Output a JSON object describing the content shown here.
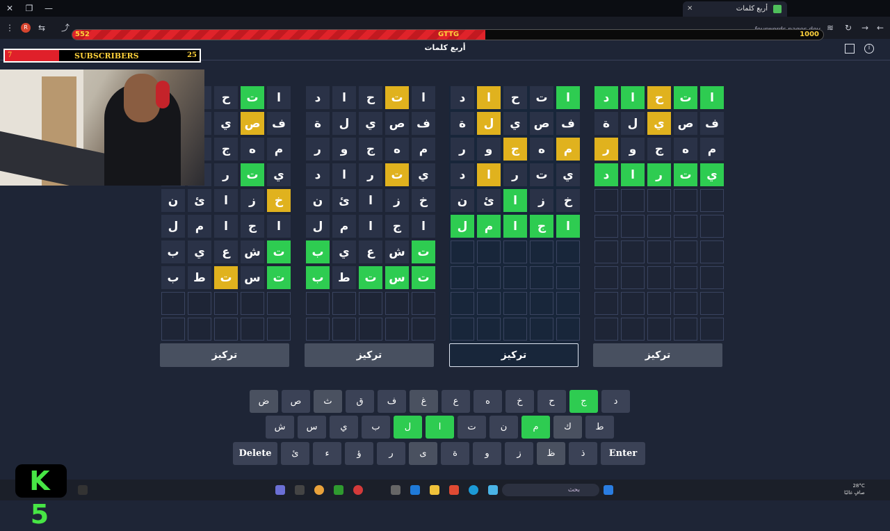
{
  "browser": {
    "tab_title": "أربع كلمات",
    "url": "fourwords.pages.dev"
  },
  "overlay": {
    "goal_bar": {
      "left": "552",
      "mid": "GTTG",
      "right": "1000",
      "progress": 0.55
    },
    "subscribers": {
      "left": "7",
      "label": "SUBSCRIBERS",
      "right": "25",
      "progress": 0.28
    },
    "logo": "K 5"
  },
  "page": {
    "title": "أربع كلمات"
  },
  "focus_label": "تركيز",
  "boards": [
    {
      "id": "board-1",
      "active": false,
      "rows": [
        [
          [
            "ا",
            "g"
          ],
          [
            "ت",
            "g"
          ],
          [
            "ح",
            "y"
          ],
          [
            "ا",
            "g"
          ],
          [
            "د",
            "g"
          ]
        ],
        [
          [
            "ف",
            "n"
          ],
          [
            "ص",
            "n"
          ],
          [
            "ي",
            "y"
          ],
          [
            "ل",
            "n"
          ],
          [
            "ة",
            "n"
          ]
        ],
        [
          [
            "م",
            "n"
          ],
          [
            "ه",
            "n"
          ],
          [
            "ج",
            "n"
          ],
          [
            "و",
            "n"
          ],
          [
            "ر",
            "y"
          ]
        ],
        [
          [
            "ي",
            "g"
          ],
          [
            "ت",
            "g"
          ],
          [
            "ر",
            "g"
          ],
          [
            "ا",
            "g"
          ],
          [
            "د",
            "g"
          ]
        ],
        [
          [
            "",
            "e"
          ],
          [
            "",
            "e"
          ],
          [
            "",
            "e"
          ],
          [
            "",
            "e"
          ],
          [
            "",
            "e"
          ]
        ],
        [
          [
            "",
            "e"
          ],
          [
            "",
            "e"
          ],
          [
            "",
            "e"
          ],
          [
            "",
            "e"
          ],
          [
            "",
            "e"
          ]
        ],
        [
          [
            "",
            "e"
          ],
          [
            "",
            "e"
          ],
          [
            "",
            "e"
          ],
          [
            "",
            "e"
          ],
          [
            "",
            "e"
          ]
        ],
        [
          [
            "",
            "e"
          ],
          [
            "",
            "e"
          ],
          [
            "",
            "e"
          ],
          [
            "",
            "e"
          ],
          [
            "",
            "e"
          ]
        ],
        [
          [
            "",
            "e"
          ],
          [
            "",
            "e"
          ],
          [
            "",
            "e"
          ],
          [
            "",
            "e"
          ],
          [
            "",
            "e"
          ]
        ],
        [
          [
            "",
            "e"
          ],
          [
            "",
            "e"
          ],
          [
            "",
            "e"
          ],
          [
            "",
            "e"
          ],
          [
            "",
            "e"
          ]
        ]
      ]
    },
    {
      "id": "board-2",
      "active": true,
      "rows": [
        [
          [
            "ا",
            "g"
          ],
          [
            "ت",
            "n"
          ],
          [
            "ح",
            "n"
          ],
          [
            "ا",
            "y"
          ],
          [
            "د",
            "n"
          ]
        ],
        [
          [
            "ف",
            "n"
          ],
          [
            "ص",
            "n"
          ],
          [
            "ي",
            "n"
          ],
          [
            "ل",
            "y"
          ],
          [
            "ة",
            "n"
          ]
        ],
        [
          [
            "م",
            "y"
          ],
          [
            "ه",
            "n"
          ],
          [
            "ج",
            "y"
          ],
          [
            "و",
            "n"
          ],
          [
            "ر",
            "n"
          ]
        ],
        [
          [
            "ي",
            "n"
          ],
          [
            "ت",
            "n"
          ],
          [
            "ر",
            "n"
          ],
          [
            "ا",
            "y"
          ],
          [
            "د",
            "n"
          ]
        ],
        [
          [
            "خ",
            "n"
          ],
          [
            "ز",
            "n"
          ],
          [
            "ا",
            "g"
          ],
          [
            "ئ",
            "n"
          ],
          [
            "ن",
            "n"
          ]
        ],
        [
          [
            "ا",
            "g"
          ],
          [
            "ج",
            "g"
          ],
          [
            "ا",
            "g"
          ],
          [
            "م",
            "g"
          ],
          [
            "ل",
            "g"
          ]
        ],
        [
          [
            "",
            "e"
          ],
          [
            "",
            "e"
          ],
          [
            "",
            "e"
          ],
          [
            "",
            "e"
          ],
          [
            "",
            "e"
          ]
        ],
        [
          [
            "",
            "e"
          ],
          [
            "",
            "e"
          ],
          [
            "",
            "e"
          ],
          [
            "",
            "e"
          ],
          [
            "",
            "e"
          ]
        ],
        [
          [
            "",
            "e"
          ],
          [
            "",
            "e"
          ],
          [
            "",
            "e"
          ],
          [
            "",
            "e"
          ],
          [
            "",
            "e"
          ]
        ],
        [
          [
            "",
            "e"
          ],
          [
            "",
            "e"
          ],
          [
            "",
            "e"
          ],
          [
            "",
            "e"
          ],
          [
            "",
            "e"
          ]
        ]
      ]
    },
    {
      "id": "board-3",
      "active": false,
      "rows": [
        [
          [
            "ا",
            "n"
          ],
          [
            "ت",
            "y"
          ],
          [
            "ح",
            "n"
          ],
          [
            "ا",
            "n"
          ],
          [
            "د",
            "n"
          ]
        ],
        [
          [
            "ف",
            "n"
          ],
          [
            "ص",
            "n"
          ],
          [
            "ي",
            "n"
          ],
          [
            "ل",
            "n"
          ],
          [
            "ة",
            "n"
          ]
        ],
        [
          [
            "م",
            "n"
          ],
          [
            "ه",
            "n"
          ],
          [
            "ج",
            "n"
          ],
          [
            "و",
            "n"
          ],
          [
            "ر",
            "n"
          ]
        ],
        [
          [
            "ي",
            "n"
          ],
          [
            "ت",
            "y"
          ],
          [
            "ر",
            "n"
          ],
          [
            "ا",
            "n"
          ],
          [
            "د",
            "n"
          ]
        ],
        [
          [
            "خ",
            "n"
          ],
          [
            "ز",
            "n"
          ],
          [
            "ا",
            "n"
          ],
          [
            "ئ",
            "n"
          ],
          [
            "ن",
            "n"
          ]
        ],
        [
          [
            "ا",
            "n"
          ],
          [
            "ج",
            "n"
          ],
          [
            "ا",
            "n"
          ],
          [
            "م",
            "n"
          ],
          [
            "ل",
            "n"
          ]
        ],
        [
          [
            "ت",
            "g"
          ],
          [
            "ش",
            "n"
          ],
          [
            "ع",
            "n"
          ],
          [
            "ي",
            "n"
          ],
          [
            "ب",
            "g"
          ]
        ],
        [
          [
            "ت",
            "g"
          ],
          [
            "س",
            "g"
          ],
          [
            "ت",
            "g"
          ],
          [
            "ط",
            "n"
          ],
          [
            "ب",
            "g"
          ]
        ],
        [
          [
            "",
            "e"
          ],
          [
            "",
            "e"
          ],
          [
            "",
            "e"
          ],
          [
            "",
            "e"
          ],
          [
            "",
            "e"
          ]
        ],
        [
          [
            "",
            "e"
          ],
          [
            "",
            "e"
          ],
          [
            "",
            "e"
          ],
          [
            "",
            "e"
          ],
          [
            "",
            "e"
          ]
        ]
      ]
    },
    {
      "id": "board-4",
      "active": false,
      "rows": [
        [
          [
            "ا",
            "n"
          ],
          [
            "ت",
            "g"
          ],
          [
            "ح",
            "n"
          ],
          [
            "",
            "n"
          ],
          [
            "",
            "n"
          ]
        ],
        [
          [
            "ف",
            "n"
          ],
          [
            "ص",
            "y"
          ],
          [
            "ي",
            "n"
          ],
          [
            "",
            "n"
          ],
          [
            "",
            "n"
          ]
        ],
        [
          [
            "م",
            "n"
          ],
          [
            "ه",
            "n"
          ],
          [
            "ج",
            "n"
          ],
          [
            "",
            "n"
          ],
          [
            "",
            "n"
          ]
        ],
        [
          [
            "ي",
            "n"
          ],
          [
            "ت",
            "g"
          ],
          [
            "ر",
            "n"
          ],
          [
            "",
            "n"
          ],
          [
            "",
            "n"
          ]
        ],
        [
          [
            "خ",
            "y"
          ],
          [
            "ز",
            "n"
          ],
          [
            "ا",
            "n"
          ],
          [
            "ئ",
            "n"
          ],
          [
            "ن",
            "n"
          ]
        ],
        [
          [
            "ا",
            "n"
          ],
          [
            "ج",
            "n"
          ],
          [
            "ا",
            "n"
          ],
          [
            "م",
            "n"
          ],
          [
            "ل",
            "n"
          ]
        ],
        [
          [
            "ت",
            "g"
          ],
          [
            "ش",
            "n"
          ],
          [
            "ع",
            "n"
          ],
          [
            "ي",
            "n"
          ],
          [
            "ب",
            "n"
          ]
        ],
        [
          [
            "ت",
            "g"
          ],
          [
            "س",
            "n"
          ],
          [
            "ت",
            "y"
          ],
          [
            "ط",
            "n"
          ],
          [
            "ب",
            "n"
          ]
        ],
        [
          [
            "",
            "e"
          ],
          [
            "",
            "e"
          ],
          [
            "",
            "e"
          ],
          [
            "",
            "e"
          ],
          [
            "",
            "e"
          ]
        ],
        [
          [
            "",
            "e"
          ],
          [
            "",
            "e"
          ],
          [
            "",
            "e"
          ],
          [
            "",
            "e"
          ],
          [
            "",
            "e"
          ]
        ]
      ]
    }
  ],
  "keyboard": {
    "row1": [
      [
        "د",
        "n"
      ],
      [
        "ج",
        "g"
      ],
      [
        "ح",
        "n"
      ],
      [
        "خ",
        "n"
      ],
      [
        "ه",
        "n"
      ],
      [
        "ع",
        "n"
      ],
      [
        "غ",
        "u"
      ],
      [
        "ف",
        "n"
      ],
      [
        "ق",
        "n"
      ],
      [
        "ث",
        "u"
      ],
      [
        "ص",
        "n"
      ],
      [
        "ض",
        "u"
      ]
    ],
    "row2": [
      [
        "ط",
        "n"
      ],
      [
        "ك",
        "u"
      ],
      [
        "م",
        "g"
      ],
      [
        "ن",
        "n"
      ],
      [
        "ت",
        "n"
      ],
      [
        "ا",
        "g"
      ],
      [
        "ل",
        "g"
      ],
      [
        "ب",
        "n"
      ],
      [
        "ي",
        "n"
      ],
      [
        "س",
        "n"
      ],
      [
        "ش",
        "n"
      ]
    ],
    "row3": [
      [
        "Enter",
        "w"
      ],
      [
        "ذ",
        "n"
      ],
      [
        "ظ",
        "u"
      ],
      [
        "ز",
        "n"
      ],
      [
        "و",
        "n"
      ],
      [
        "ة",
        "n"
      ],
      [
        "ى",
        "u"
      ],
      [
        "ر",
        "n"
      ],
      [
        "ؤ",
        "n"
      ],
      [
        "ء",
        "n"
      ],
      [
        "ئ",
        "n"
      ],
      [
        "Delete",
        "w"
      ]
    ]
  },
  "taskbar": {
    "search_placeholder": "بحث",
    "weather_temp": "28°C",
    "weather_desc": "صافٍ غالبًا"
  }
}
